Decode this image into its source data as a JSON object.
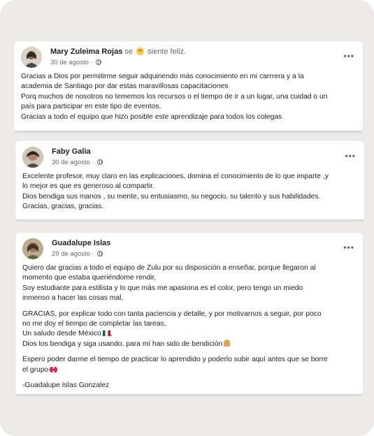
{
  "posts": [
    {
      "name": "Mary Zuleima Rojas",
      "feeling_prefix": "se",
      "feeling_text": "siente feliz.",
      "date": "30 de agosto ·",
      "lines": [
        "Gracias a Dios por permitirme seguir adquiriendo más conocimiento en mi carrrera y a la",
        "academia de Santiago por dar estas maravillosas capacitaciones",
        "Porq muchos de nosotros no tememos los recursos o el tiempo de ir a un lugar, una cuidad o un",
        "país para participar en este tipo de eventos.",
        "Gracias a todo el equipo que hizo posible este aprendizaje para todos los colegas"
      ]
    },
    {
      "name": "Faby Galia",
      "date": "30 de agosto ·",
      "lines": [
        "Excelente profesor, muy claro en las explicaciones, domina el conocimiento de lo que imparte ,y",
        "lo mejor es que es generoso al compartir.",
        "Dios bendiga sus manos , su mente, su entusiasmo, su negocio, su talento y sus habilidades.",
        "Gracias, gracias, gracias."
      ]
    },
    {
      "name": "Guadalupe Islas",
      "date": "29 de agosto ·",
      "lines": [
        "Quiero dar gracias a todo el equipo de Zulu por su disposición a enseñar, porque llegaron al",
        "momento que estaba queriéndome rendir,",
        "Soy estudiante para estilista y lo que más me apasiona es el color, pero tengo un miedo",
        "inmenso a hacer las cosas mal,",
        "GRACIAS, por explicar todo con tanta paciencia y detalle, y por motivarnos a seguir, por poco",
        "no me doy el tiempo de completar las tareas,",
        "Un saludo desde México",
        "Dios los bendiga y siga usando, para mí han sido de bendición",
        "Espero poder darme el tiempo de practicar lo aprendido y poderlo subir aquí antes que se borre",
        "el grupo",
        "-Guadalupe Islas Gonzalez"
      ]
    }
  ],
  "more_label": "•••",
  "icons": {
    "feeling": "smiley-face-icon",
    "privacy": "globe-icon",
    "flag": "mexico-flag-icon",
    "pray": "folded-hands-icon",
    "bow": "ribbon-icon"
  }
}
